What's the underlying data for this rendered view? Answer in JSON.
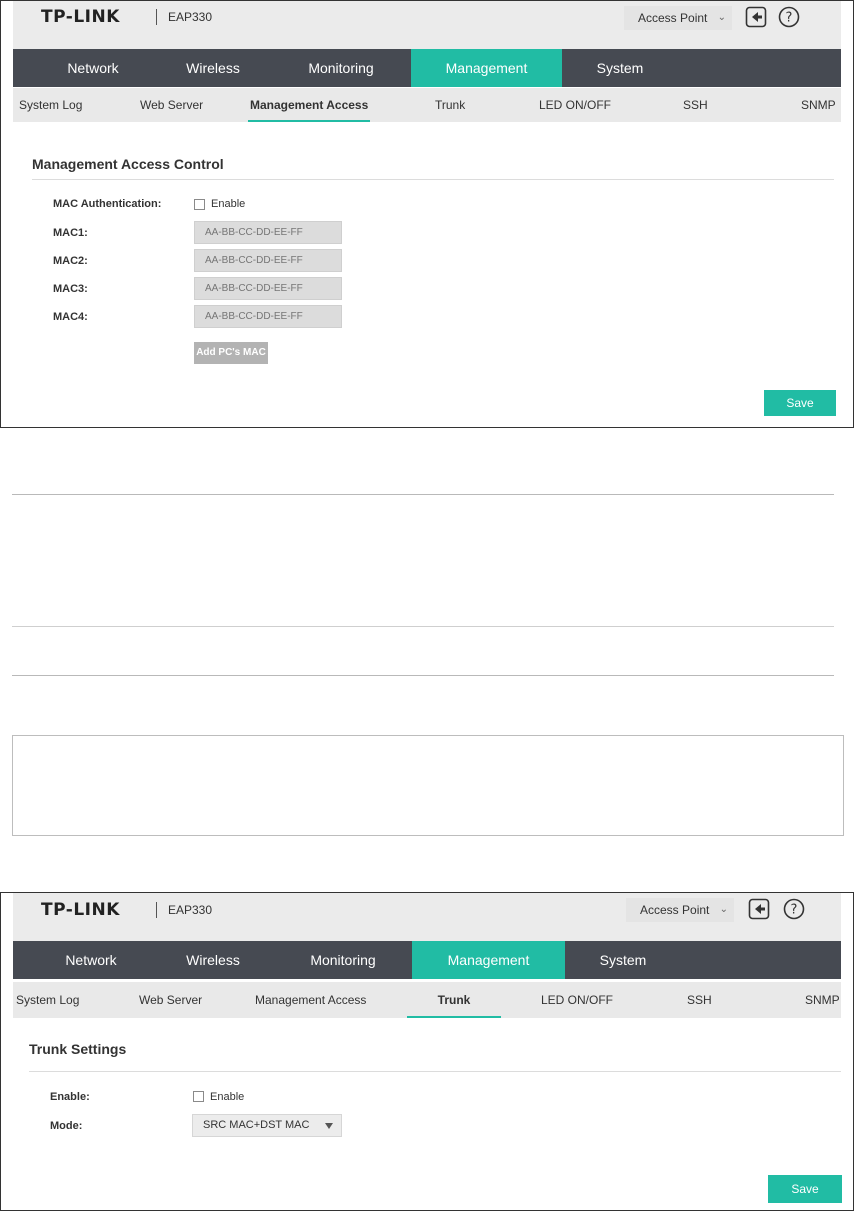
{
  "screens": [
    {
      "brand": "TP-LINK",
      "model": "EAP330",
      "mode_select": "Access Point",
      "nav": [
        "Network",
        "Wireless",
        "Monitoring",
        "Management",
        "System"
      ],
      "active_nav": "Management",
      "subnav": [
        "System Log",
        "Web Server",
        "Management Access",
        "Trunk",
        "LED ON/OFF",
        "SSH",
        "SNMP"
      ],
      "active_subnav": "Management Access",
      "section_title": "Management Access Control",
      "mac_auth_label": "MAC Authentication:",
      "enable_label": "Enable",
      "mac_fields": [
        {
          "label": "MAC1:",
          "placeholder": "AA-BB-CC-DD-EE-FF"
        },
        {
          "label": "MAC2:",
          "placeholder": "AA-BB-CC-DD-EE-FF"
        },
        {
          "label": "MAC3:",
          "placeholder": "AA-BB-CC-DD-EE-FF"
        },
        {
          "label": "MAC4:",
          "placeholder": "AA-BB-CC-DD-EE-FF"
        }
      ],
      "add_pc_mac": "Add PC's MAC",
      "save": "Save"
    },
    {
      "brand": "TP-LINK",
      "model": "EAP330",
      "mode_select": "Access Point",
      "nav": [
        "Network",
        "Wireless",
        "Monitoring",
        "Management",
        "System"
      ],
      "active_nav": "Management",
      "subnav": [
        "System Log",
        "Web Server",
        "Management Access",
        "Trunk",
        "LED ON/OFF",
        "SSH",
        "SNMP"
      ],
      "active_subnav": "Trunk",
      "section_title": "Trunk Settings",
      "enable_row_label": "Enable:",
      "enable_label": "Enable",
      "mode_label": "Mode:",
      "mode_value": "SRC MAC+DST MAC",
      "save": "Save"
    }
  ],
  "colors": {
    "accent": "#21bca4",
    "nav_bg": "#464a52",
    "subnav_bg": "#e9e9e9",
    "header_bg": "#ebebeb"
  }
}
